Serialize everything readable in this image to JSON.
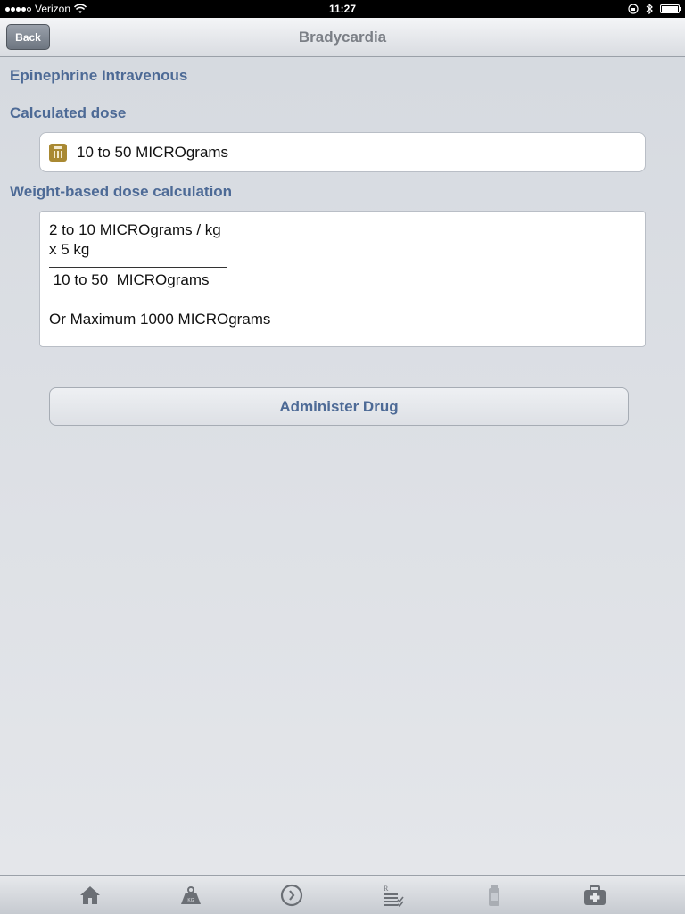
{
  "status_bar": {
    "carrier": "Verizon",
    "time": "11:27"
  },
  "nav": {
    "title": "Bradycardia",
    "back_label": "Back"
  },
  "drug": {
    "name": "Epinephrine Intravenous",
    "calculated_dose_label": "Calculated dose",
    "calculated_dose_value": "10 to 50 MICROgrams",
    "weight_calc_label": "Weight-based dose calculation",
    "calc_line1": "2 to 10 MICROgrams / kg",
    "calc_line2": "x 5 kg",
    "calc_result": " 10 to 50  MICROgrams",
    "calc_max": "Or Maximum 1000 MICROgrams"
  },
  "actions": {
    "administer_label": "Administer Drug"
  },
  "tabs": [
    {
      "icon": "home-icon"
    },
    {
      "icon": "weight-icon"
    },
    {
      "icon": "timer-icon"
    },
    {
      "icon": "prescription-list-icon"
    },
    {
      "icon": "vial-icon"
    },
    {
      "icon": "medical-kit-icon"
    }
  ],
  "colors": {
    "accent": "#4d6a96",
    "icon_gray": "#6b6f75",
    "calculator_icon": "#a98932"
  }
}
